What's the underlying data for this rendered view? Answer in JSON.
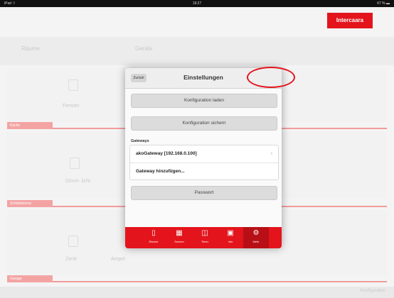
{
  "statusbar": {
    "left": "iPad ⌔",
    "center": "19:27",
    "right": "67 % ▬"
  },
  "app": {
    "brand_label": "Intercaara"
  },
  "background": {
    "header_left": "Räume",
    "header_mid": "Geräte",
    "sections": [
      {
        "tag": "Küche",
        "items": [
          "Fenster"
        ]
      },
      {
        "tag": "Schlafzimmer",
        "items": [
          "Dimm-\nlicht"
        ]
      },
      {
        "tag": "Garage",
        "items": [
          "Zentr",
          "Ampel"
        ]
      }
    ],
    "bottom_label": "Konfiguration"
  },
  "dialog": {
    "back_label": "Zurück",
    "title": "Einstellungen",
    "load_config_label": "Konfiguration laden",
    "save_config_label": "Konfiguration sichern",
    "gateways_label": "Gateways",
    "gateways": [
      {
        "label": "akoGateway [192.168.0.100]",
        "chevron": "›"
      },
      {
        "label": "Gateway hinzufügen...",
        "chevron": ""
      }
    ],
    "password_label": "Passwort"
  },
  "tabbar": {
    "tabs": [
      {
        "icon": "▯",
        "label": "Räume",
        "icon_name": "door-icon"
      },
      {
        "icon": "▦",
        "label": "Szenen",
        "icon_name": "scenes-icon"
      },
      {
        "icon": "◫",
        "label": "Timer",
        "icon_name": "timer-icon"
      },
      {
        "icon": "▣",
        "label": "Info",
        "icon_name": "info-icon"
      },
      {
        "icon": "⚙",
        "label": "Mehr",
        "icon_name": "wrench-icon"
      }
    ],
    "active_index": 4
  },
  "colors": {
    "accent": "#e3141c",
    "accent_dark": "#b80f16"
  }
}
